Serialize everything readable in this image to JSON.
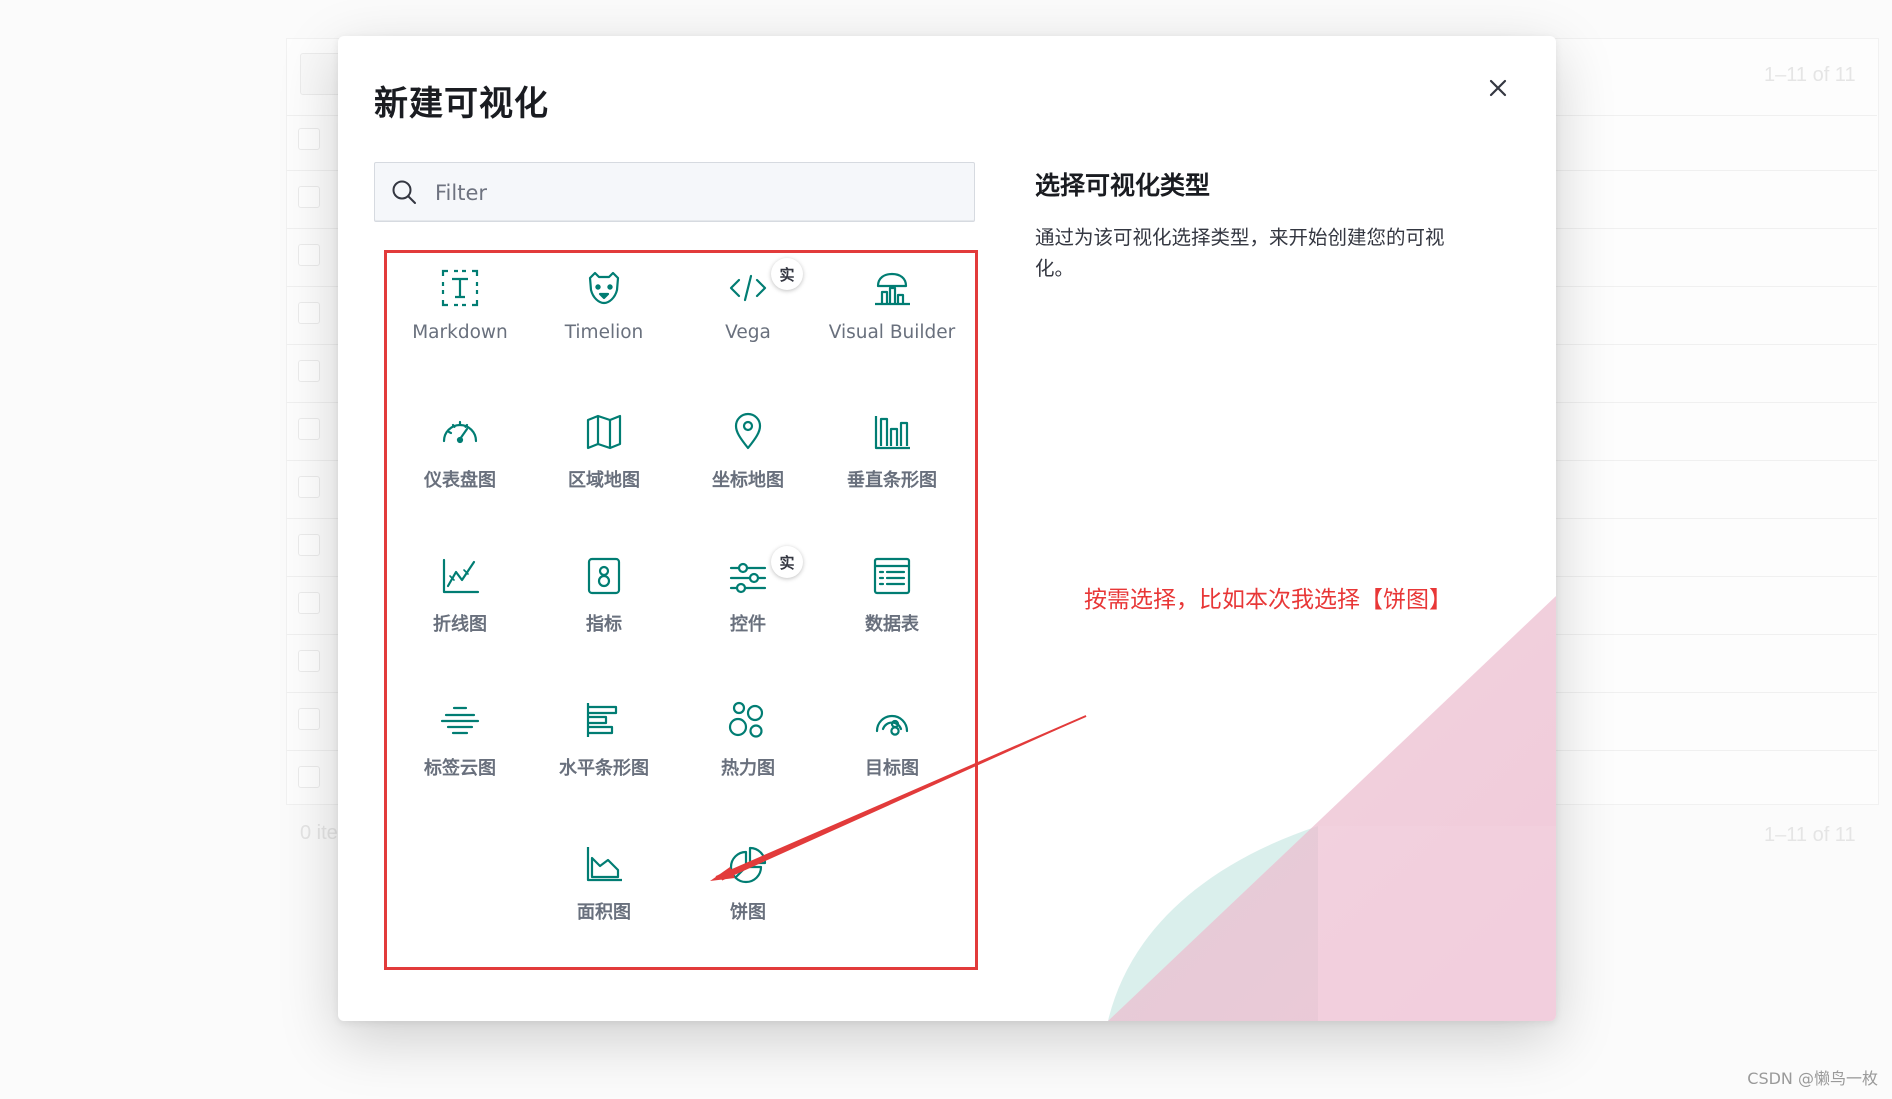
{
  "background_table": {
    "pagination_top": "1–11 of 11",
    "footer_left": "0 ite",
    "pagination_bottom": "1–11 of 11"
  },
  "modal": {
    "title": "新建可视化",
    "close_icon": "close-icon",
    "search": {
      "placeholder": "Filter",
      "value": ""
    },
    "types": [
      {
        "label": "Markdown",
        "icon": "markdown-icon"
      },
      {
        "label": "Timelion",
        "icon": "timelion-icon"
      },
      {
        "label": "Vega",
        "icon": "code-icon",
        "badge": "实"
      },
      {
        "label": "Visual Builder",
        "icon": "visual-builder-icon"
      },
      {
        "label": "仪表盘图",
        "icon": "gauge-icon"
      },
      {
        "label": "区域地图",
        "icon": "region-map-icon"
      },
      {
        "label": "坐标地图",
        "icon": "map-marker-icon"
      },
      {
        "label": "垂直条形图",
        "icon": "vertical-bar-icon"
      },
      {
        "label": "折线图",
        "icon": "line-chart-icon"
      },
      {
        "label": "指标",
        "icon": "metric-icon"
      },
      {
        "label": "控件",
        "icon": "controls-icon",
        "badge": "实"
      },
      {
        "label": "数据表",
        "icon": "data-table-icon"
      },
      {
        "label": "标签云图",
        "icon": "tag-cloud-icon"
      },
      {
        "label": "水平条形图",
        "icon": "horizontal-bar-icon"
      },
      {
        "label": "热力图",
        "icon": "heatmap-icon"
      },
      {
        "label": "目标图",
        "icon": "goal-icon"
      },
      {
        "label": "面积图",
        "icon": "area-chart-icon"
      },
      {
        "label": "饼图",
        "icon": "pie-chart-icon"
      }
    ],
    "description": {
      "title": "选择可视化类型",
      "text": "通过为该可视化选择类型，来开始创建您的可视化。"
    },
    "annotation": "按需选择，比如本次我选择【饼图】"
  },
  "watermark": "CSDN @懒鸟一枚",
  "colors": {
    "accent": "#017d73",
    "annotation": "#e23b3b"
  }
}
